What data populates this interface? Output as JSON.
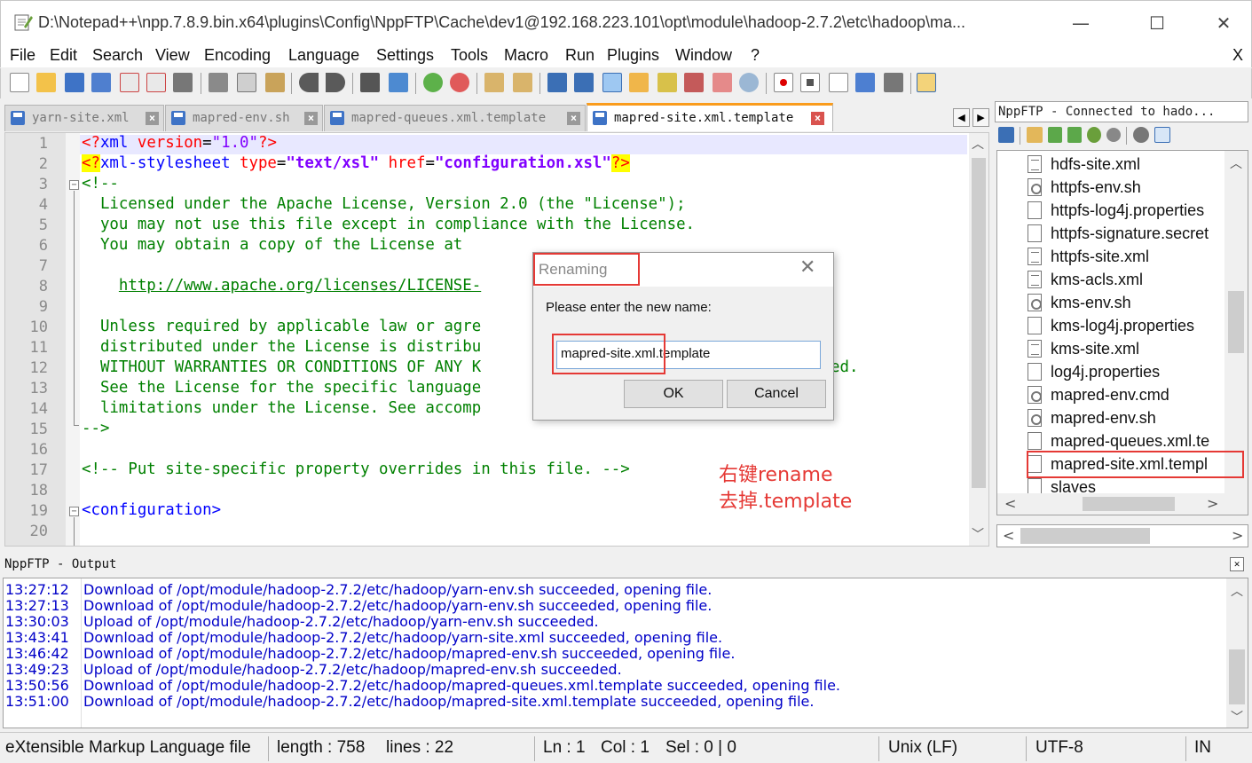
{
  "window": {
    "title": "D:\\Notepad++\\npp.7.8.9.bin.x64\\plugins\\Config\\NppFTP\\Cache\\dev1@192.168.223.101\\opt\\module\\hadoop-2.7.2\\etc\\hadoop\\ma...",
    "minimize": "—",
    "maximize": "☐",
    "close": "✕"
  },
  "menu": [
    "File",
    "Edit",
    "Search",
    "View",
    "Encoding",
    "Language",
    "Settings",
    "Tools",
    "Macro",
    "Run",
    "Plugins",
    "Window",
    "?"
  ],
  "menu_close": "X",
  "tabs": [
    {
      "label": "yarn-site.xml",
      "active": false
    },
    {
      "label": "mapred-env.sh",
      "active": false
    },
    {
      "label": "mapred-queues.xml.template",
      "active": false
    },
    {
      "label": "mapred-site.xml.template",
      "active": true
    }
  ],
  "tab_nav": {
    "left": "◀",
    "right": "▶"
  },
  "editor": {
    "line_numbers": [
      "1",
      "2",
      "3",
      "4",
      "5",
      "6",
      "7",
      "8",
      "9",
      "10",
      "11",
      "12",
      "13",
      "14",
      "15",
      "16",
      "17",
      "18",
      "19",
      "20"
    ],
    "lines": {
      "l1": {
        "open": "<?",
        "name": "xml",
        "attr": " version",
        "eq": "=",
        "val": "\"1.0\"",
        "close": "?>"
      },
      "l2": {
        "open": "<?",
        "name": "xml-stylesheet",
        "a1": " type",
        "eq1": "=",
        "v1": "\"text/xsl\"",
        "a2": " href",
        "eq2": "=",
        "v2": "\"configuration.xsl\"",
        "close": "?>"
      },
      "l3": "<!--",
      "l4": "  Licensed under the Apache License, Version 2.0 (the \"License\");",
      "l5": "  you may not use this file except in compliance with the License.",
      "l6": "  You may obtain a copy of the License at",
      "l8a": "    ",
      "l8": "http://www.apache.org/licenses/LICENSE-",
      "l10": "  Unless required by applicable law or agre",
      "l11": "  distributed under the License is distribu",
      "l12": "  WITHOUT WARRANTIES OR CONDITIONS OF ANY K",
      "l12b": "ed.",
      "l13": "  See the License for the specific language",
      "l14": "  limitations under the License. See accomp",
      "l15": "-->",
      "l17": "<!-- Put site-specific property overrides in this file. -->",
      "l19": "<configuration>",
      "l20": ""
    },
    "fold_minus": "−"
  },
  "dialog": {
    "title": "Renaming",
    "close": "✕",
    "prompt": "Please enter the new name:",
    "input_value": "mapred-site.xml.template",
    "ok": "OK",
    "cancel": "Cancel"
  },
  "ftp": {
    "header": "NppFTP - Connected to hado...",
    "files": [
      {
        "name": "hdfs-site.xml",
        "icon": "lines"
      },
      {
        "name": "httpfs-env.sh",
        "icon": "gear"
      },
      {
        "name": "httpfs-log4j.properties",
        "icon": "blank"
      },
      {
        "name": "httpfs-signature.secret",
        "icon": "blank"
      },
      {
        "name": "httpfs-site.xml",
        "icon": "lines"
      },
      {
        "name": "kms-acls.xml",
        "icon": "lines"
      },
      {
        "name": "kms-env.sh",
        "icon": "gear"
      },
      {
        "name": "kms-log4j.properties",
        "icon": "blank"
      },
      {
        "name": "kms-site.xml",
        "icon": "lines"
      },
      {
        "name": "log4j.properties",
        "icon": "blank"
      },
      {
        "name": "mapred-env.cmd",
        "icon": "gear"
      },
      {
        "name": "mapred-env.sh",
        "icon": "gear"
      },
      {
        "name": "mapred-queues.xml.te",
        "icon": "blank"
      },
      {
        "name": "mapred-site.xml.templ",
        "icon": "blank"
      },
      {
        "name": "slaves",
        "icon": "blank"
      }
    ]
  },
  "annotation": {
    "line1": "右键rename",
    "line2": "去掉.template",
    "color": "#e53935"
  },
  "output": {
    "header": "NppFTP - Output",
    "close": "✕",
    "rows": [
      {
        "time": "13:27:12",
        "msg": "Download of /opt/module/hadoop-2.7.2/etc/hadoop/yarn-env.sh succeeded, opening file."
      },
      {
        "time": "13:27:13",
        "msg": "Download of /opt/module/hadoop-2.7.2/etc/hadoop/yarn-env.sh succeeded, opening file."
      },
      {
        "time": "13:30:03",
        "msg": "Upload of /opt/module/hadoop-2.7.2/etc/hadoop/yarn-env.sh succeeded."
      },
      {
        "time": "13:43:41",
        "msg": "Download of /opt/module/hadoop-2.7.2/etc/hadoop/yarn-site.xml succeeded, opening file."
      },
      {
        "time": "13:46:42",
        "msg": "Download of /opt/module/hadoop-2.7.2/etc/hadoop/mapred-env.sh succeeded, opening file."
      },
      {
        "time": "13:49:23",
        "msg": "Upload of /opt/module/hadoop-2.7.2/etc/hadoop/mapred-env.sh succeeded."
      },
      {
        "time": "13:50:56",
        "msg": "Download of /opt/module/hadoop-2.7.2/etc/hadoop/mapred-queues.xml.template succeeded, opening file."
      },
      {
        "time": "13:51:00",
        "msg": "Download of /opt/module/hadoop-2.7.2/etc/hadoop/mapred-site.xml.template succeeded, opening file."
      }
    ]
  },
  "status": {
    "filetype": "eXtensible Markup Language file",
    "length": "length : 758",
    "lines": "lines : 22",
    "ln": "Ln : 1",
    "col": "Col : 1",
    "sel": "Sel : 0 | 0",
    "eol": "Unix (LF)",
    "encoding": "UTF-8",
    "mode": "IN"
  },
  "arrows": {
    "up": "︿",
    "down": "﹀",
    "left": "<",
    "right": ">"
  }
}
